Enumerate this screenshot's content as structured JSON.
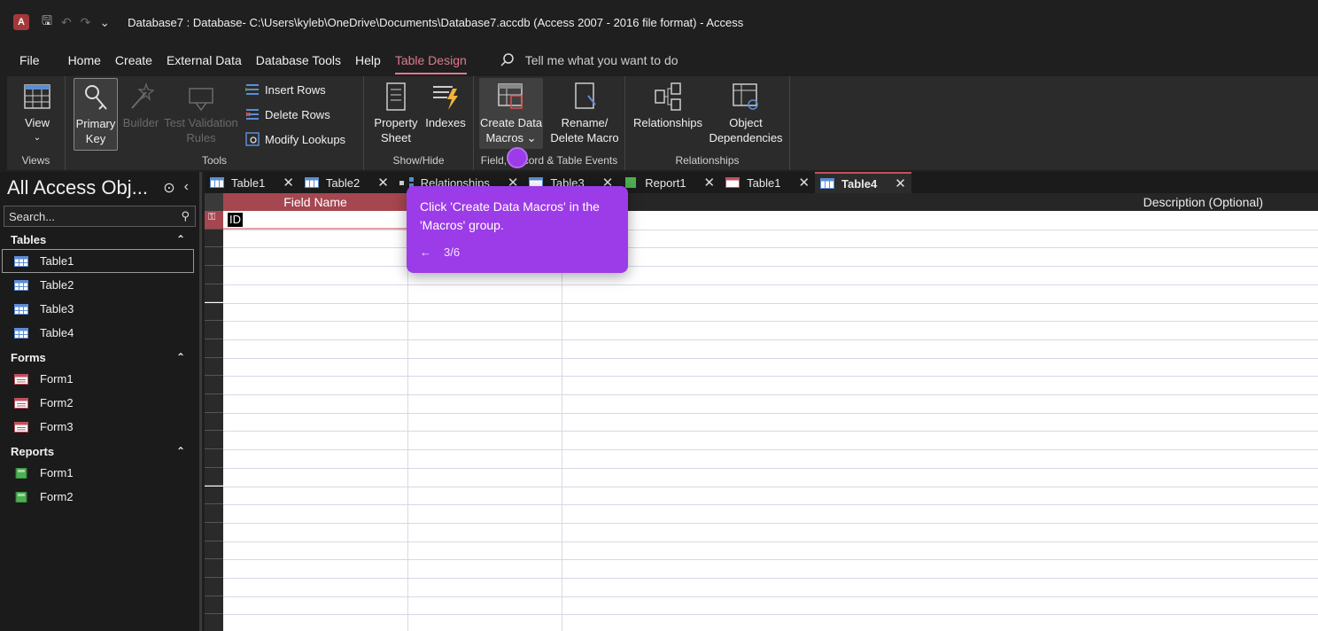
{
  "titlebar": {
    "app_letter": "A",
    "save_glyph": "🖫",
    "undo_glyph": "↶",
    "redo_glyph": "↷",
    "more_glyph": "⌄",
    "title": "Database7 : Database- C:\\Users\\kyleb\\OneDrive\\Documents\\Database7.accdb (Access 2007 - 2016 file format)  -  Access"
  },
  "menu": {
    "items": [
      "File",
      "Home",
      "Create",
      "External Data",
      "Database Tools",
      "Help",
      "Table Design"
    ],
    "search_placeholder": "Tell me what you want to do"
  },
  "ribbon": {
    "views": {
      "label": "Views",
      "view_btn": "View"
    },
    "tools": {
      "label": "Tools",
      "primary_key": [
        "Primary",
        "Key"
      ],
      "builder": "Builder",
      "test_validation": [
        "Test Validation",
        "Rules"
      ],
      "insert_rows": "Insert Rows",
      "delete_rows": "Delete Rows",
      "modify_lookups": "Modify Lookups"
    },
    "showhide": {
      "label": "Show/Hide",
      "property_sheet": [
        "Property",
        "Sheet"
      ],
      "indexes": "Indexes"
    },
    "events": {
      "label": "Field, Record & Table Events",
      "create_data_macros": [
        "Create Data",
        "Macros ⌄"
      ],
      "rename_delete": [
        "Rename/",
        "Delete Macro"
      ]
    },
    "relationships": {
      "label": "Relationships",
      "relationships_btn": "Relationships",
      "object_dependencies": [
        "Object",
        "Dependencies"
      ]
    }
  },
  "nav": {
    "title": "All Access Obj...",
    "search_placeholder": "Search...",
    "sections": [
      {
        "name": "Tables",
        "items": [
          "Table1",
          "Table2",
          "Table3",
          "Table4"
        ]
      },
      {
        "name": "Forms",
        "items": [
          "Form1",
          "Form2",
          "Form3"
        ]
      },
      {
        "name": "Reports",
        "items": [
          "Form1",
          "Form2"
        ]
      }
    ]
  },
  "doctabs": [
    "Table1",
    "Table2",
    "Relationships",
    "Table3",
    "Report1",
    "Table1",
    "Table4"
  ],
  "grid": {
    "col_field": "Field Name",
    "col_desc": "Description (Optional)",
    "first_field": "ID"
  },
  "tooltip": {
    "message": "Click 'Create Data Macros' in the 'Macros' group.",
    "back": "←",
    "step": "3/6"
  },
  "colors": {
    "accent": "#9c3be8",
    "table_design": "#e07a8b",
    "field_header": "#a64650"
  }
}
